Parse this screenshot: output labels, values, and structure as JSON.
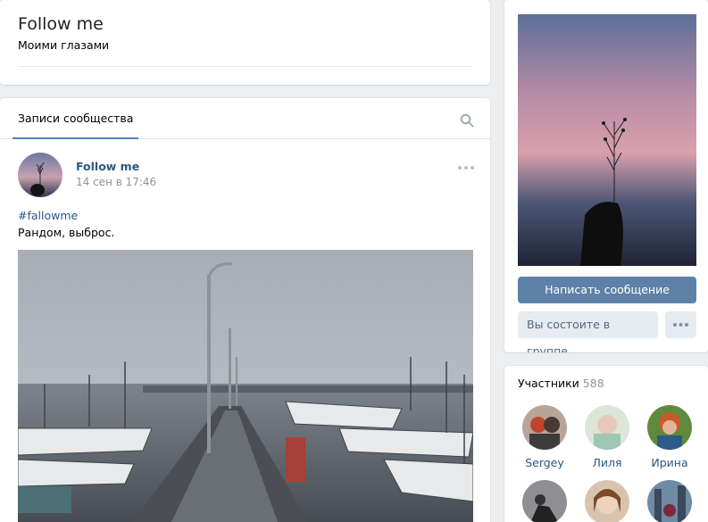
{
  "header": {
    "title": "Follow me",
    "status": "Моими глазами"
  },
  "wall": {
    "tab_label": "Записи сообщества",
    "post": {
      "author": "Follow me",
      "date": "14 сен в 17:46",
      "hashtag": "#fallowme",
      "text": "Рандом, выброс."
    }
  },
  "sidebar": {
    "send_message_label": "Написать сообщение",
    "membership_label": "Вы состоите в группе",
    "membership_chevron": "⌵"
  },
  "members": {
    "title": "Участники",
    "count": "588",
    "items": [
      {
        "name": "Sergey"
      },
      {
        "name": "Лиля"
      },
      {
        "name": "Ирина"
      },
      {
        "name": ""
      },
      {
        "name": ""
      },
      {
        "name": ""
      }
    ]
  },
  "colors": {
    "link": "#2a5885",
    "primary_button": "#5e81a8",
    "secondary_button": "#e5ebf1",
    "page_bg": "#edeef0"
  },
  "icons": [
    "search-icon",
    "more-dots-icon",
    "chevron-down-icon"
  ]
}
